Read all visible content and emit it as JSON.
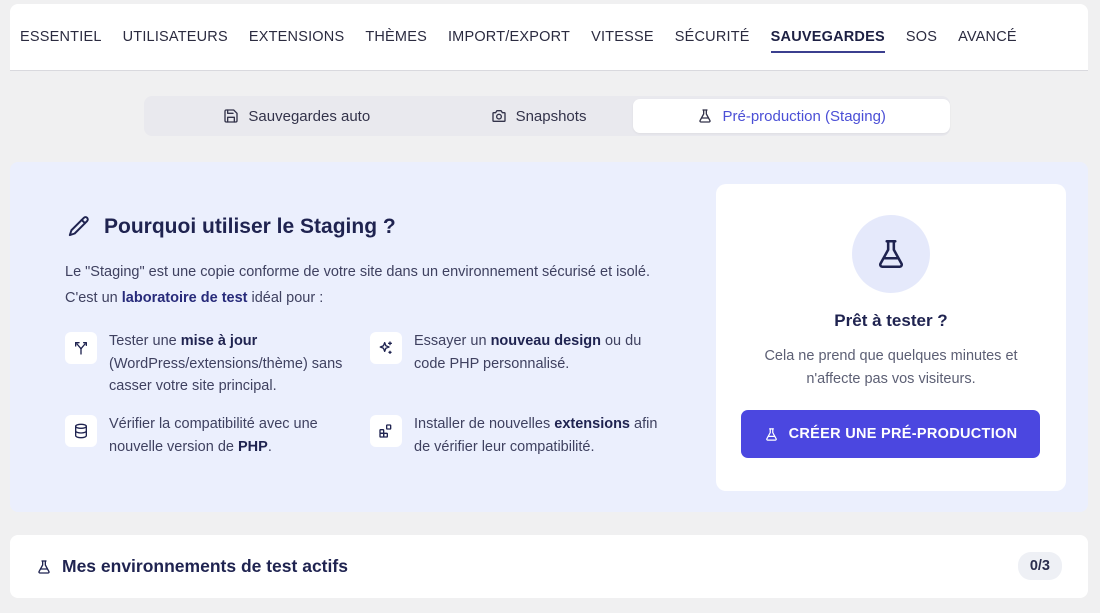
{
  "nav": {
    "items": [
      {
        "label": "ESSENTIEL",
        "active": false
      },
      {
        "label": "UTILISATEURS",
        "active": false
      },
      {
        "label": "EXTENSIONS",
        "active": false
      },
      {
        "label": "THÈMES",
        "active": false
      },
      {
        "label": "IMPORT/EXPORT",
        "active": false
      },
      {
        "label": "VITESSE",
        "active": false
      },
      {
        "label": "SÉCURITÉ",
        "active": false
      },
      {
        "label": "SAUVEGARDES",
        "active": true
      },
      {
        "label": "SOS",
        "active": false
      },
      {
        "label": "AVANCÉ",
        "active": false
      }
    ]
  },
  "subtabs": {
    "auto": {
      "label": "Sauvegardes auto",
      "icon": "save-icon"
    },
    "snapshots": {
      "label": "Snapshots",
      "icon": "camera-icon"
    },
    "staging": {
      "label": "Pré-production (Staging)",
      "icon": "flask-icon",
      "active": true
    }
  },
  "why": {
    "title": "Pourquoi utiliser le Staging ?",
    "intro_part1": "Le \"Staging\" est une copie conforme de votre site dans un environnement sécurisé et isolé. C'est un ",
    "intro_bold": "laboratoire de test",
    "intro_part2": " idéal pour :"
  },
  "features": {
    "f1": {
      "pre": "Tester une ",
      "bold": "mise à jour",
      "post": " (WordPress/extensions/thème) sans casser votre site principal.",
      "icon": "git-branch-icon"
    },
    "f2": {
      "pre": "Essayer un ",
      "bold": "nouveau design",
      "post": " ou du code PHP personnalisé.",
      "icon": "sparkles-icon"
    },
    "f3": {
      "pre": "Vérifier la compatibilité avec une nouvelle version de ",
      "bold": "PHP",
      "post": ".",
      "icon": "database-icon"
    },
    "f4": {
      "pre": "Installer de nouvelles ",
      "bold": "extensions",
      "post": " afin de vérifier leur compatibilité.",
      "icon": "blocks-icon"
    }
  },
  "ready": {
    "title": "Prêt à tester ?",
    "description": "Cela ne prend que quelques minutes et n'affecte pas vos visiteurs.",
    "button": "CRÉER UNE PRÉ-PRODUCTION"
  },
  "envs": {
    "title": "Mes environnements de test actifs",
    "count": "0/3"
  },
  "colors": {
    "accent": "#4b47e0",
    "panel_bg": "#ebeffd",
    "active_tab_text": "#4b4fd6"
  }
}
